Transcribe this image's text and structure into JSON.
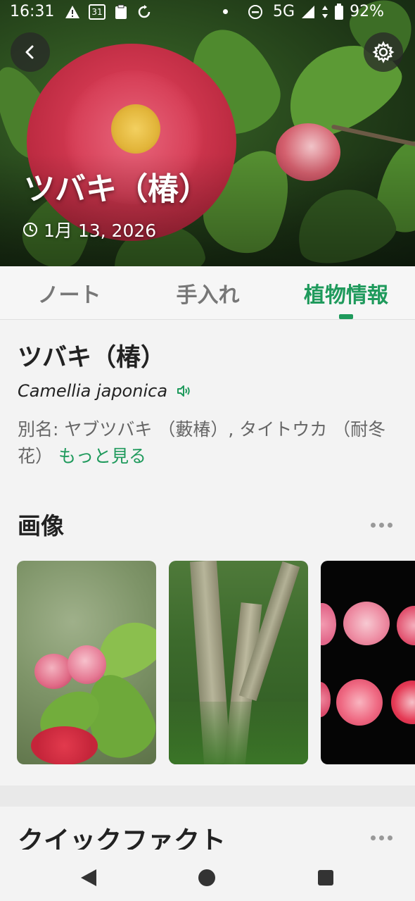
{
  "status_bar": {
    "time": "16:31",
    "calendar_day": "31",
    "network": "5G",
    "battery": "92%"
  },
  "hero": {
    "title": "ツバキ（椿）",
    "date": "1月 13, 2026"
  },
  "tabs": [
    {
      "label": "ノート",
      "active": false
    },
    {
      "label": "手入れ",
      "active": false
    },
    {
      "label": "植物情報",
      "active": true
    }
  ],
  "plant": {
    "name": "ツバキ（椿）",
    "scientific_name": "Camellia japonica",
    "aliases": "別名: ヤブツバキ （藪椿）, タイトウカ （耐冬花）",
    "more_link": "もっと見る"
  },
  "sections": {
    "images_title": "画像",
    "quick_facts_title": "クイックファクト"
  },
  "images": [
    {
      "name": "camellia-buds-photo"
    },
    {
      "name": "camellia-trunk-photo"
    },
    {
      "name": "camellia-flowers-grid-photo"
    }
  ],
  "colors": {
    "accent": "#1f9a5c",
    "background": "#f3f3f3",
    "text_primary": "#222222",
    "text_secondary": "#666666"
  },
  "icons": {
    "back": "chevron-left-icon",
    "settings": "gear-icon",
    "clock": "clock-icon",
    "speaker": "speaker-icon",
    "more": "more-dots-icon"
  }
}
